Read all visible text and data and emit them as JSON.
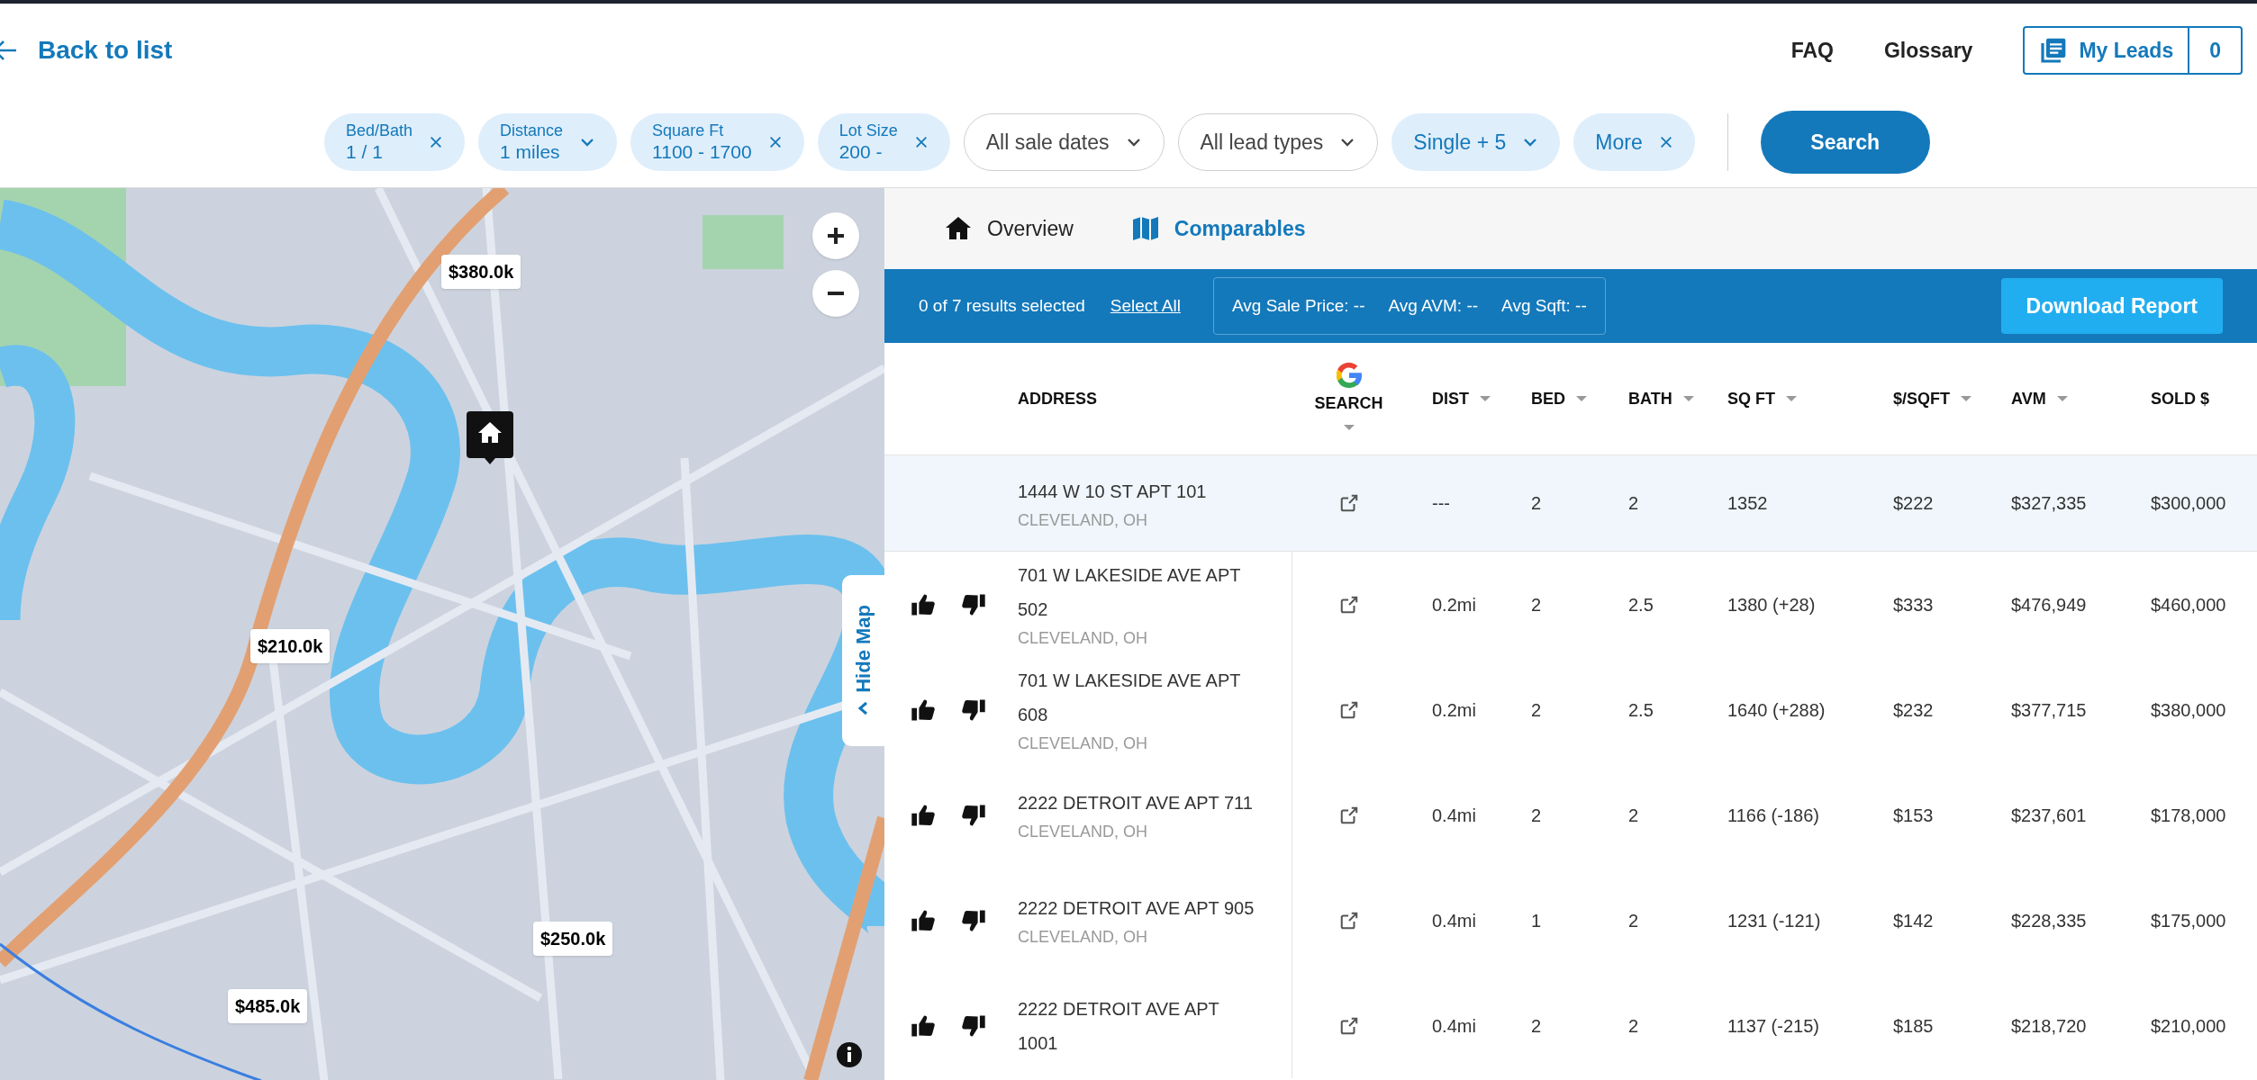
{
  "header": {
    "back_link": "Back to list",
    "nav_links": [
      "FAQ",
      "Glossary"
    ],
    "my_leads": {
      "label": "My Leads",
      "count": "0"
    }
  },
  "filters": [
    {
      "label": "Bed/Bath",
      "text": "1 / 1",
      "active": true,
      "kind": "clear"
    },
    {
      "label": "Distance",
      "text": "1 miles",
      "active": true,
      "kind": "dropdown"
    },
    {
      "label": "Square Ft",
      "text": "1100 - 1700",
      "active": true,
      "kind": "clear"
    },
    {
      "label": "Lot Size",
      "text": "200 -",
      "active": true,
      "kind": "clear"
    },
    {
      "text": "All sale dates",
      "active": false,
      "kind": "dropdown"
    },
    {
      "text": "All lead types",
      "active": false,
      "kind": "dropdown"
    },
    {
      "text": "Single  + 5",
      "active": true,
      "kind": "dropdown"
    },
    {
      "text": "More",
      "active": true,
      "kind": "clear"
    }
  ],
  "search_button": "Search",
  "map": {
    "pins": [
      {
        "kind": "price",
        "text": "$380.0k"
      },
      {
        "kind": "price",
        "text": "$210.0k"
      },
      {
        "kind": "price",
        "text": "$250.0k"
      },
      {
        "kind": "price",
        "text": "$485.0k"
      },
      {
        "kind": "home"
      }
    ],
    "hide_map": "Hide Map"
  },
  "tabs": [
    {
      "kind": "house",
      "label": "Overview",
      "selected": false
    },
    {
      "kind": "map",
      "label": "Comparables",
      "selected": true
    }
  ],
  "selection_bar": {
    "count": "0 of 7 results selected",
    "select_all": "Select All",
    "stats": [
      "Avg Sale Price: --",
      "Avg AVM: --",
      "Avg Sqft: --"
    ],
    "download": "Download Report"
  },
  "table": {
    "columns": [
      {
        "kind": "text",
        "label": "ADDRESS",
        "sortable": false
      },
      {
        "kind": "google",
        "label": "SEARCH",
        "sortable": true
      },
      {
        "kind": "text",
        "label": "DIST",
        "sortable": true
      },
      {
        "kind": "text",
        "label": "BED",
        "sortable": true
      },
      {
        "kind": "text",
        "label": "BATH",
        "sortable": true
      },
      {
        "kind": "text",
        "label": "SQ FT",
        "sortable": true
      },
      {
        "kind": "text",
        "label": "$/SQFT",
        "sortable": true
      },
      {
        "kind": "text",
        "label": "AVM",
        "sortable": true
      },
      {
        "kind": "text",
        "label": "SOLD $",
        "sortable": false
      }
    ],
    "rows": [
      {
        "kind": "subject",
        "city": "CLEVELAND, OH",
        "cells": [
          "1444 W 10 ST APT 101",
          "",
          "---",
          "2",
          "2",
          "1352",
          "$222",
          "$327,335",
          "$300,000"
        ]
      },
      {
        "kind": "comp",
        "city": "CLEVELAND, OH",
        "cells": [
          "701 W LAKESIDE AVE APT 502",
          "",
          "0.2mi",
          "2",
          "2.5",
          "1380 (+28)",
          "$333",
          "$476,949",
          "$460,000"
        ]
      },
      {
        "kind": "comp",
        "city": "CLEVELAND, OH",
        "cells": [
          "701 W LAKESIDE AVE APT 608",
          "",
          "0.2mi",
          "2",
          "2.5",
          "1640 (+288)",
          "$232",
          "$377,715",
          "$380,000"
        ]
      },
      {
        "kind": "comp",
        "city": "CLEVELAND, OH",
        "cells": [
          "2222 DETROIT AVE APT 711",
          "",
          "0.4mi",
          "2",
          "2",
          "1166 (-186)",
          "$153",
          "$237,601",
          "$178,000"
        ]
      },
      {
        "kind": "comp",
        "city": "CLEVELAND, OH",
        "cells": [
          "2222 DETROIT AVE APT 905",
          "",
          "0.4mi",
          "1",
          "2",
          "1231 (-121)",
          "$142",
          "$228,335",
          "$175,000"
        ]
      },
      {
        "kind": "comp",
        "cells": [
          "2222 DETROIT AVE APT 1001",
          "",
          "0.4mi",
          "2",
          "2",
          "1137 (-215)",
          "$185",
          "$218,720",
          "$210,000"
        ]
      }
    ]
  }
}
